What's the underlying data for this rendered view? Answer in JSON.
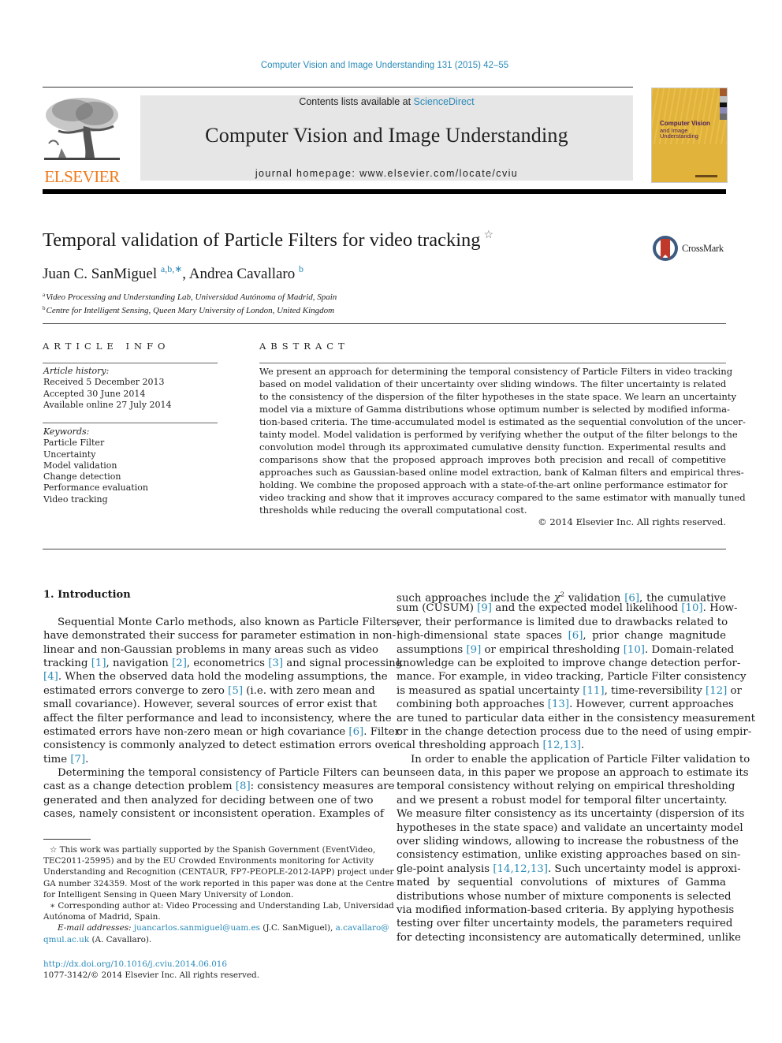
{
  "journal_reference": "Computer Vision and Image Understanding 131 (2015) 42–55",
  "header": {
    "publisher_logo_text": "ELSEVIER",
    "contents_prefix": "Contents lists available at ",
    "contents_link": "ScienceDirect",
    "journal_title": "Computer Vision and Image Understanding",
    "homepage": "journal homepage: www.elsevier.com/locate/cviu",
    "cover_title": "Computer Vision",
    "cover_subtitle_1": "and Image",
    "cover_subtitle_2": "Understanding"
  },
  "article": {
    "title": "Temporal validation of Particle Filters for video tracking",
    "title_note_mark": "☆",
    "crossmark_label": "CrossMark",
    "authors": [
      {
        "name": "Juan C. SanMiguel",
        "marks": "a,b,∗"
      },
      {
        "name": "Andrea Cavallaro",
        "marks": "b"
      }
    ],
    "author_separator": ", ",
    "affiliations": [
      {
        "mark": "a",
        "text": "Video Processing and Understanding Lab, Universidad Autónoma of Madrid, Spain"
      },
      {
        "mark": "b",
        "text": "Centre for Intelligent Sensing, Queen Mary University of London, United Kingdom"
      }
    ]
  },
  "article_info": {
    "label": "ARTICLE INFO",
    "history_heading": "Article history:",
    "history": [
      "Received 5 December 2013",
      "Accepted 30 June 2014",
      "Available online 27 July 2014"
    ],
    "keywords_heading": "Keywords:",
    "keywords": [
      "Particle Filter",
      "Uncertainty",
      "Model validation",
      "Change detection",
      "Performance evaluation",
      "Video tracking"
    ]
  },
  "abstract": {
    "label": "ABSTRACT",
    "lines": [
      "We present an approach for determining the temporal consistency of Particle Filters in video tracking",
      "based on model validation of their uncertainty over sliding windows. The filter uncertainty is related",
      "to the consistency of the dispersion of the filter hypotheses in the state space. We learn an uncertainty",
      "model via a mixture of Gamma distributions whose optimum number is selected by modified informa-",
      "tion-based criteria. The time-accumulated model is estimated as the sequential convolution of the uncer-",
      "tainty model. Model validation is performed by verifying whether the output of the filter belongs to the",
      "convolution model through its approximated cumulative density function. Experimental results and",
      "comparisons show that the proposed approach improves both precision and recall of competitive",
      "approaches such as Gaussian-based online model extraction, bank of Kalman filters and empirical thres-",
      "holding. We combine the proposed approach with a state-of-the-art online performance estimator for",
      "video tracking and show that it improves accuracy compared to the same estimator with manually tuned",
      "thresholds while reducing the overall computational cost."
    ],
    "copyright": "© 2014 Elsevier Inc. All rights reserved."
  },
  "body": {
    "section_heading": "1. Introduction",
    "left_column": [
      {
        "indent": true,
        "parts": [
          {
            "t": "Sequential Monte Carlo methods, also known as Particle Filters,"
          }
        ]
      },
      {
        "parts": [
          {
            "t": "have demonstrated their success for parameter estimation in non-"
          }
        ]
      },
      {
        "parts": [
          {
            "t": "linear and non-Gaussian problems in many areas such as video"
          }
        ]
      },
      {
        "parts": [
          {
            "t": "tracking "
          },
          {
            "ref": "[1]"
          },
          {
            "t": ", navigation "
          },
          {
            "ref": "[2]"
          },
          {
            "t": ", econometrics "
          },
          {
            "ref": "[3]"
          },
          {
            "t": " and signal processing"
          }
        ]
      },
      {
        "parts": [
          {
            "ref": "[4]"
          },
          {
            "t": ". When the observed data hold the modeling assumptions, the"
          }
        ]
      },
      {
        "parts": [
          {
            "t": "estimated errors converge to zero "
          },
          {
            "ref": "[5]"
          },
          {
            "t": " (i.e. with zero mean and"
          }
        ]
      },
      {
        "parts": [
          {
            "t": "small covariance). However, several sources of error exist that"
          }
        ]
      },
      {
        "parts": [
          {
            "t": "affect the filter performance and lead to inconsistency, where the"
          }
        ]
      },
      {
        "parts": [
          {
            "t": "estimated errors have non-zero mean or high covariance "
          },
          {
            "ref": "[6]"
          },
          {
            "t": ". Filter"
          }
        ]
      },
      {
        "parts": [
          {
            "t": "consistency is commonly analyzed to detect estimation errors over"
          }
        ]
      },
      {
        "last": true,
        "parts": [
          {
            "t": "time "
          },
          {
            "ref": "[7]"
          },
          {
            "t": "."
          }
        ]
      },
      {
        "indent": true,
        "parts": [
          {
            "t": "Determining the temporal consistency of Particle Filters can be"
          }
        ]
      },
      {
        "parts": [
          {
            "t": "cast as a change detection problem "
          },
          {
            "ref": "[8]"
          },
          {
            "t": ": consistency measures are"
          }
        ]
      },
      {
        "parts": [
          {
            "t": "generated and then analyzed for deciding between one of two"
          }
        ]
      },
      {
        "parts": [
          {
            "t": "cases, namely consistent or inconsistent operation. Examples of"
          }
        ]
      }
    ],
    "right_column": [
      {
        "parts": [
          {
            "t": "such approaches include the "
          },
          {
            "chi": "χ",
            "sup": "2"
          },
          {
            "t": " validation "
          },
          {
            "ref": "[6]"
          },
          {
            "t": ", the cumulative"
          }
        ]
      },
      {
        "parts": [
          {
            "t": "sum (CUSUM) "
          },
          {
            "ref": "[9]"
          },
          {
            "t": " and the expected model likelihood "
          },
          {
            "ref": "[10]"
          },
          {
            "t": ". How-"
          }
        ]
      },
      {
        "parts": [
          {
            "t": "ever, their performance is limited due to drawbacks related to"
          }
        ]
      },
      {
        "parts": [
          {
            "t": "high-dimensional state spaces "
          },
          {
            "ref": "[6]"
          },
          {
            "t": ", prior change magnitude"
          }
        ]
      },
      {
        "parts": [
          {
            "t": "assumptions "
          },
          {
            "ref": "[9]"
          },
          {
            "t": " or empirical thresholding "
          },
          {
            "ref": "[10]"
          },
          {
            "t": ". Domain-related"
          }
        ]
      },
      {
        "parts": [
          {
            "t": "knowledge can be exploited to improve change detection perfor-"
          }
        ]
      },
      {
        "parts": [
          {
            "t": "mance. For example, in video tracking, Particle Filter consistency"
          }
        ]
      },
      {
        "parts": [
          {
            "t": "is measured as spatial uncertainty "
          },
          {
            "ref": "[11]"
          },
          {
            "t": ", time-reversibility "
          },
          {
            "ref": "[12]"
          },
          {
            "t": " or"
          }
        ]
      },
      {
        "parts": [
          {
            "t": "combining both approaches "
          },
          {
            "ref": "[13]"
          },
          {
            "t": ". However, current approaches"
          }
        ]
      },
      {
        "parts": [
          {
            "t": "are tuned to particular data either in the consistency measurement"
          }
        ]
      },
      {
        "parts": [
          {
            "t": "or in the change detection process due to the need of using empir-"
          }
        ]
      },
      {
        "last": true,
        "parts": [
          {
            "t": "ical thresholding approach "
          },
          {
            "ref": "[12,13]"
          },
          {
            "t": "."
          }
        ]
      },
      {
        "indent": true,
        "parts": [
          {
            "t": "In order to enable the application of Particle Filter validation to"
          }
        ]
      },
      {
        "parts": [
          {
            "t": "unseen data, in this paper we propose an approach to estimate its"
          }
        ]
      },
      {
        "parts": [
          {
            "t": "temporal consistency without relying on empirical thresholding"
          }
        ]
      },
      {
        "parts": [
          {
            "t": "and we present a robust model for temporal filter uncertainty."
          }
        ]
      },
      {
        "parts": [
          {
            "t": "We measure filter consistency as its uncertainty (dispersion of its"
          }
        ]
      },
      {
        "parts": [
          {
            "t": "hypotheses in the state space) and validate an uncertainty model"
          }
        ]
      },
      {
        "parts": [
          {
            "t": "over sliding windows, allowing to increase the robustness of the"
          }
        ]
      },
      {
        "parts": [
          {
            "t": "consistency estimation, unlike existing approaches based on sin-"
          }
        ]
      },
      {
        "parts": [
          {
            "t": "gle-point analysis "
          },
          {
            "ref": "[14,12,13]"
          },
          {
            "t": ". Such uncertainty model is approxi-"
          }
        ]
      },
      {
        "parts": [
          {
            "t": "mated by sequential convolutions of mixtures of Gamma"
          }
        ]
      },
      {
        "parts": [
          {
            "t": "distributions whose number of mixture components is selected"
          }
        ]
      },
      {
        "parts": [
          {
            "t": "via modified information-based criteria. By applying hypothesis"
          }
        ]
      },
      {
        "parts": [
          {
            "t": "testing over filter uncertainty models, the parameters required"
          }
        ]
      },
      {
        "parts": [
          {
            "t": "for detecting inconsistency are automatically determined, unlike"
          }
        ]
      }
    ]
  },
  "footnotes": {
    "lines": [
      {
        "cls": "ind",
        "parts": [
          {
            "t": "☆ This work was partially supported by the Spanish Government (EventVideo,"
          }
        ]
      },
      {
        "parts": [
          {
            "t": "TEC2011-25995) and by the EU Crowded Environments monitoring for Activity"
          }
        ]
      },
      {
        "parts": [
          {
            "t": "Understanding and Recognition (CENTAUR, FP7-PEOPLE-2012-IAPP) project under"
          }
        ]
      },
      {
        "parts": [
          {
            "t": "GA number 324359. Most of the work reported in this paper was done at the Centre"
          }
        ]
      },
      {
        "last": true,
        "parts": [
          {
            "t": "for Intelligent Sensing in Queen Mary University of London."
          }
        ]
      },
      {
        "cls": "ind",
        "parts": [
          {
            "t": "∗ Corresponding author at: Video Processing and Understanding Lab, Universidad"
          }
        ]
      },
      {
        "last": true,
        "parts": [
          {
            "t": "Autónoma of Madrid, Spain."
          }
        ]
      },
      {
        "cls": "ind2",
        "parts": [
          {
            "em": "E-mail addresses: "
          },
          {
            "ref": "juancarlos.sanmiguel@uam.es"
          },
          {
            "t": " (J.C. SanMiguel), "
          },
          {
            "ref": "a.cavallaro@"
          }
        ]
      },
      {
        "last": true,
        "parts": [
          {
            "ref": "qmul.ac.uk"
          },
          {
            "t": " (A. Cavallaro)."
          }
        ]
      }
    ]
  },
  "doi_link": "http://dx.doi.org/10.1016/j.cviu.2014.06.016",
  "issn_line": "1077-3142/© 2014 Elsevier Inc. All rights reserved.",
  "colors": {
    "link": "#2a8ab8",
    "elsevier_orange": "#f07a1a",
    "cover_yellow": "#e2b33a",
    "banner_gray": "#e6e6e6"
  }
}
